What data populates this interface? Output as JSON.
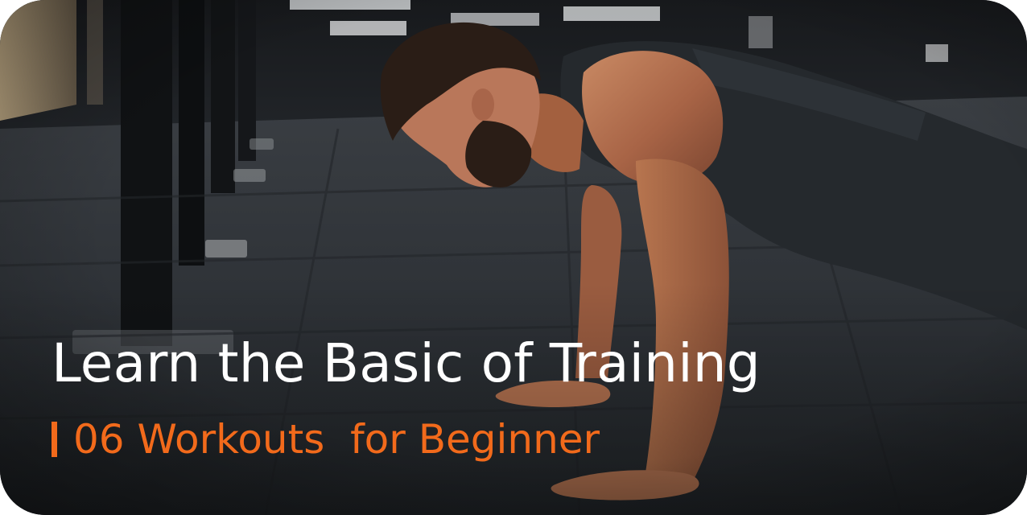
{
  "card": {
    "title": "Learn the Basic of Training",
    "subtitle": "06 Workouts  for Beginner",
    "image": "man-doing-pushup-in-gym-photo"
  },
  "colors": {
    "title": "#ffffff",
    "accent": "#f26a1b"
  }
}
